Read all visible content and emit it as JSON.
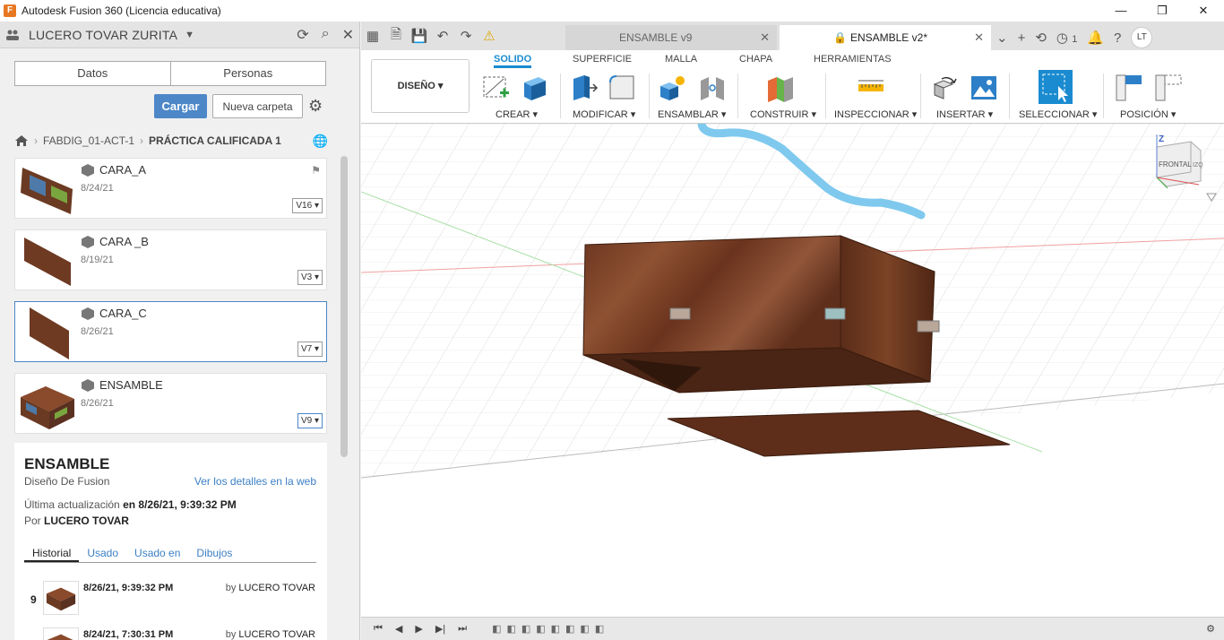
{
  "app": {
    "title": "Autodesk Fusion 360 (Licencia educativa)",
    "icon_letter": "F",
    "window_controls": [
      "—",
      "❐",
      "✕"
    ]
  },
  "left_panel": {
    "user": "LUCERO TOVAR ZURITA",
    "segment": [
      "Datos",
      "Personas"
    ],
    "upload_label": "Cargar",
    "new_folder_label": "Nueva carpeta",
    "breadcrumb": {
      "project": "FABDIG_01-ACT-1",
      "folder": "PRÁCTICA CALIFICADA 1"
    },
    "files": [
      {
        "name": "CARA_A",
        "date": "8/24/21",
        "version": "V16"
      },
      {
        "name": "CARA _B",
        "date": "8/19/21",
        "version": "V3"
      },
      {
        "name": "CARA_C",
        "date": "8/26/21",
        "version": "V7"
      },
      {
        "name": "ENSAMBLE",
        "date": "8/26/21",
        "version": "V9"
      }
    ],
    "details": {
      "title": "ENSAMBLE",
      "type": "Diseño De Fusion",
      "web_link": "Ver los detalles en la web",
      "updated_label": "Última actualización",
      "updated_value": "en 8/26/21, 9:39:32 PM",
      "by_label": "Por",
      "by_value": "LUCERO TOVAR",
      "tabs": [
        "Historial",
        "Usado",
        "Usado en",
        "Dibujos"
      ],
      "history": [
        {
          "num": "9",
          "date": "8/26/21, 9:39:32 PM",
          "by": "by",
          "user": "LUCERO TOVAR"
        },
        {
          "num": "",
          "date": "8/24/21, 7:30:31 PM",
          "by": "by",
          "user": "LUCERO TOVAR"
        }
      ]
    }
  },
  "doc_tabs": {
    "inactive": "ENSAMBLE v9",
    "active": "ENSAMBLE v2*",
    "close": "✕",
    "jobs_count": "1",
    "avatar": "LT"
  },
  "ribbon": {
    "workspace": "DISEÑO ▾",
    "tabs": [
      "SOLIDO",
      "SUPERFICIE",
      "MALLA",
      "CHAPA",
      "HERRAMIENTAS"
    ],
    "groups": [
      "CREAR ▾",
      "MODIFICAR ▾",
      "ENSAMBLAR ▾",
      "CONSTRUIR ▾",
      "INSPECCIONAR ▾",
      "INSERTAR ▾",
      "SELECCIONAR ▾",
      "POSICIÓN ▾"
    ]
  },
  "viewcube": {
    "label": "FRONTAL",
    "axis": "Z",
    "side": "IZQ"
  },
  "colors": {
    "accent": "#1a8bd0",
    "button_blue": "#4d87c7",
    "wood": "#7a3f24",
    "stroke_blue": "#7fc9ee"
  }
}
